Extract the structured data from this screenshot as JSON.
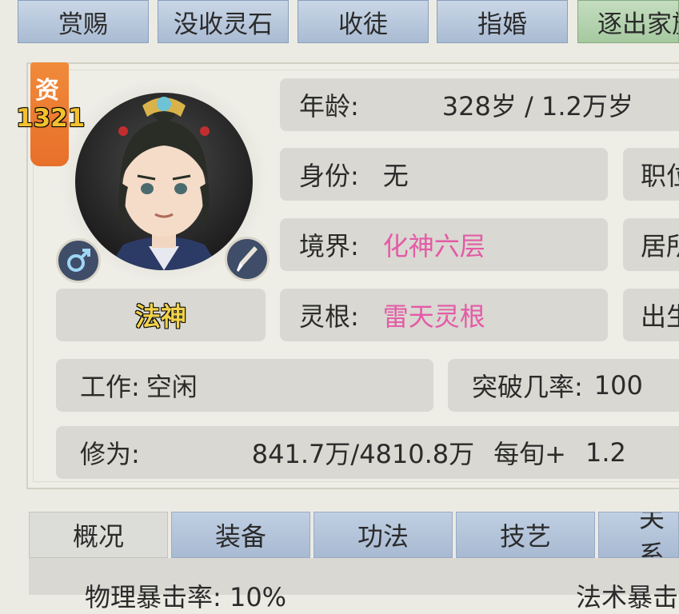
{
  "top_actions": [
    "赏赐",
    "没收灵石",
    "收徒",
    "指婚",
    "逐出家族"
  ],
  "character": {
    "aptitude_label": "资",
    "aptitude_value": "1321",
    "title": "法神",
    "gender_icon": "male-icon",
    "edit_icon": "brush-icon"
  },
  "info": {
    "age_label": "年龄:",
    "age_value": "328岁 / 1.2万岁",
    "identity_label": "身份:",
    "identity_value": "无",
    "position_label": "职位",
    "realm_label": "境界:",
    "realm_value": "化神六层",
    "residence_label": "居所",
    "root_label": "灵根:",
    "root_value": "雷天灵根",
    "birth_label": "出生",
    "work_label": "工作:",
    "work_value": "空闲",
    "breakthrough_label": "突破几率:",
    "breakthrough_value": "100",
    "cultivation_label": "修为:",
    "cultivation_value": "841.7万/4810.8万",
    "per_turn_label": "每旬+",
    "per_turn_value": "1.2"
  },
  "tabs": [
    "概况",
    "装备",
    "功法",
    "技艺",
    "关系"
  ],
  "bottom": {
    "left_text": "物理暴击率: 10%",
    "right_text": "法术暴击"
  },
  "colors": {
    "accent_pink": "#e45aa6",
    "badge_orange": "#e86f2a",
    "tab_blue": "#a8bad2",
    "action_green": "#a6c9a0"
  }
}
